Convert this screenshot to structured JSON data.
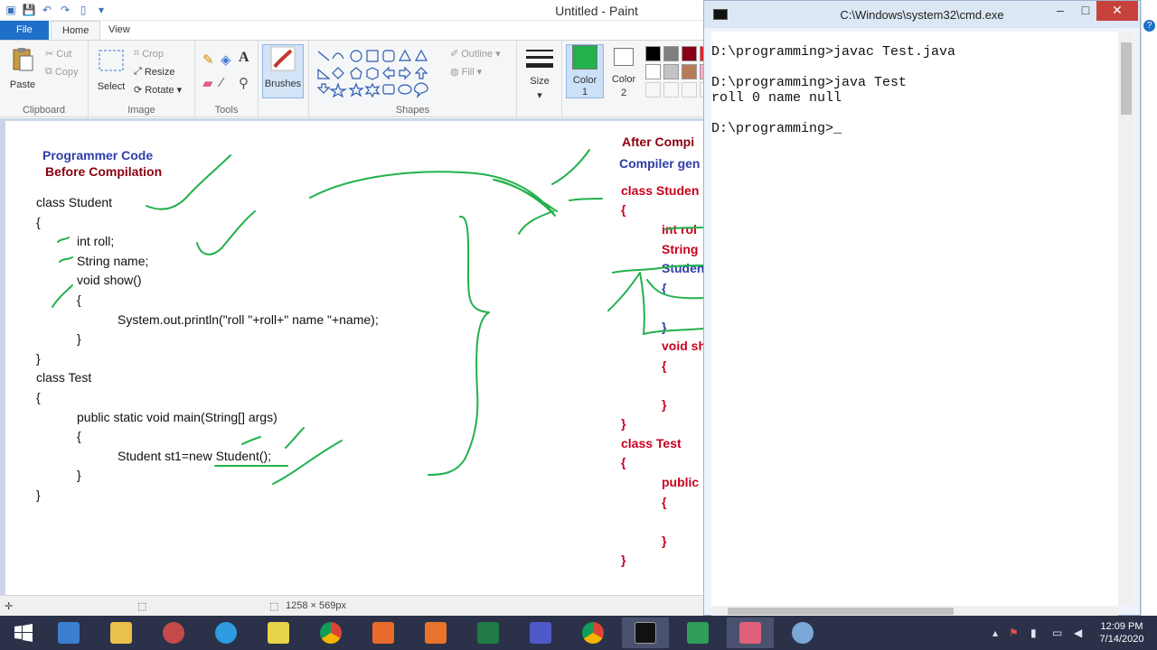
{
  "paint": {
    "title": "Untitled - Paint",
    "tabs": {
      "file": "File",
      "home": "Home",
      "view": "View"
    },
    "clipboard": {
      "paste": "Paste",
      "cut": "Cut",
      "copy": "Copy",
      "label": "Clipboard"
    },
    "image": {
      "select": "Select",
      "crop": "Crop",
      "resize": "Resize",
      "rotate": "Rotate",
      "label": "Image"
    },
    "tools": {
      "label": "Tools"
    },
    "brushes": {
      "label": "Brushes"
    },
    "shapes": {
      "outline": "Outline",
      "fill": "Fill",
      "label": "Shapes"
    },
    "size": {
      "label": "Size"
    },
    "color1": {
      "label": "Color",
      "num": "1",
      "color": "#22b14c"
    },
    "color2": {
      "label": "Color",
      "num": "2",
      "color": "#ffffff"
    },
    "palette": [
      "#000000",
      "#7f7f7f",
      "#880015",
      "#ed1c24",
      "#ffffff",
      "#c3c3c3",
      "#b97a57",
      "#ffaec9"
    ],
    "status": {
      "dimensions": "1258 × 569px"
    },
    "canvas": {
      "left_heading_1": "Programmer Code",
      "left_heading_2": "Before Compilation",
      "left_code": [
        "class Student",
        "{",
        "int roll;",
        "String name;",
        "void show()",
        "{",
        "System.out.println(\"roll \"+roll+\" name \"+name);",
        "}",
        "}",
        "class Test",
        "{",
        "public static void main(String[] args)",
        "{",
        "Student st1=new Student();",
        "}",
        "}"
      ],
      "right_heading_1": "After Compi",
      "right_heading_2": "Compiler gen",
      "right_code": [
        "class Studen",
        "{",
        "int rol",
        "String",
        "Studen",
        "{",
        "}",
        "void sh",
        "{",
        "}",
        "}",
        "class Test",
        "{",
        "public",
        "{",
        "}",
        "}"
      ]
    }
  },
  "cmd": {
    "title": "C:\\Windows\\system32\\cmd.exe",
    "lines": [
      "D:\\programming>javac Test.java",
      "",
      "D:\\programming>java Test",
      "roll 0 name null",
      "",
      "D:\\programming>_"
    ]
  },
  "taskbar": {
    "time": "12:09 PM",
    "date": "7/14/2020"
  }
}
